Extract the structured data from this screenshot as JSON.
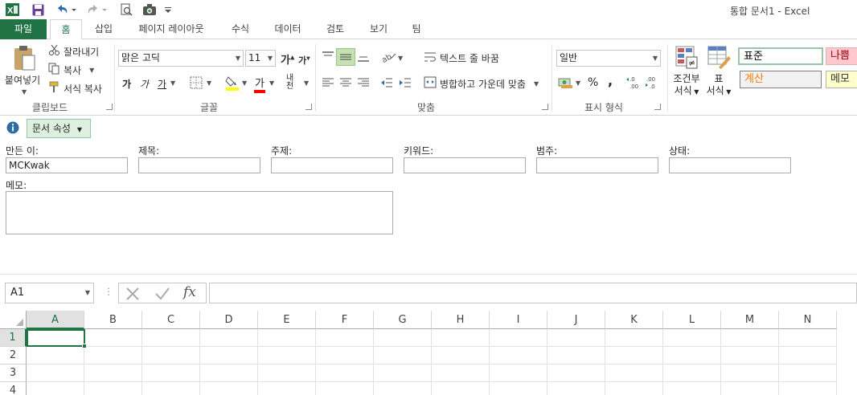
{
  "window": {
    "title": "통합 문서1 - Excel"
  },
  "colors": {
    "excel_green": "#217346",
    "bad_fill": "#ffc7ce",
    "bad_text": "#9c0006",
    "calc_text": "#fa7d00",
    "calc_fill": "#f2f2f2",
    "memo_fill": "#ffffcc",
    "select_border": "#217346"
  },
  "qat": {
    "icons": [
      "excel-logo-icon",
      "save-icon",
      "undo-icon",
      "redo-icon",
      "print-preview-icon",
      "camera-icon",
      "customize-icon"
    ]
  },
  "tabs": {
    "file": "파일",
    "home": "홈",
    "insert": "삽입",
    "page_layout": "페이지 레이아웃",
    "formulas": "수식",
    "data": "데이터",
    "review": "검토",
    "view": "보기",
    "team": "팀"
  },
  "ribbon": {
    "clipboard": {
      "paste": "붙여넣기",
      "cut": "잘라내기",
      "copy": "복사",
      "format_painter": "서식 복사",
      "label": "클립보드"
    },
    "font": {
      "name": "맑은 고딕",
      "size": "11",
      "bold": "가",
      "italic": "가",
      "underline": "가",
      "color_glyph": "가",
      "phonetic": "내천",
      "label": "글꼴"
    },
    "alignment": {
      "wrap_text": "텍스트 줄 바꿈",
      "merge_center": "병합하고 가운데 맞춤",
      "label": "맞춤"
    },
    "number": {
      "format": "일반",
      "percent": "%",
      "comma": ",",
      "label": "표시 형식"
    },
    "styles": {
      "cond_format_1": "조건부",
      "cond_format_2": "서식",
      "table_1": "표",
      "table_2": "서식",
      "normal": "표준",
      "bad": "나쁨",
      "calc": "계산",
      "memo": "메모"
    }
  },
  "doc_props": {
    "toggle": "문서 속성",
    "author_label": "만든 이:",
    "author_value": "MCKwak",
    "title_label": "제목:",
    "title_value": "",
    "subject_label": "주제:",
    "subject_value": "",
    "keywords_label": "키워드:",
    "keywords_value": "",
    "category_label": "범주:",
    "category_value": "",
    "status_label": "상태:",
    "status_value": "",
    "comments_label": "메모:",
    "comments_value": ""
  },
  "formula_bar": {
    "name_box": "A1",
    "content": "",
    "fx": "fx"
  },
  "grid": {
    "columns": [
      "A",
      "B",
      "C",
      "D",
      "E",
      "F",
      "G",
      "H",
      "I",
      "J",
      "K",
      "L",
      "M",
      "N"
    ],
    "rows": [
      "1",
      "2",
      "3",
      "4"
    ],
    "active_cell": "A1"
  }
}
